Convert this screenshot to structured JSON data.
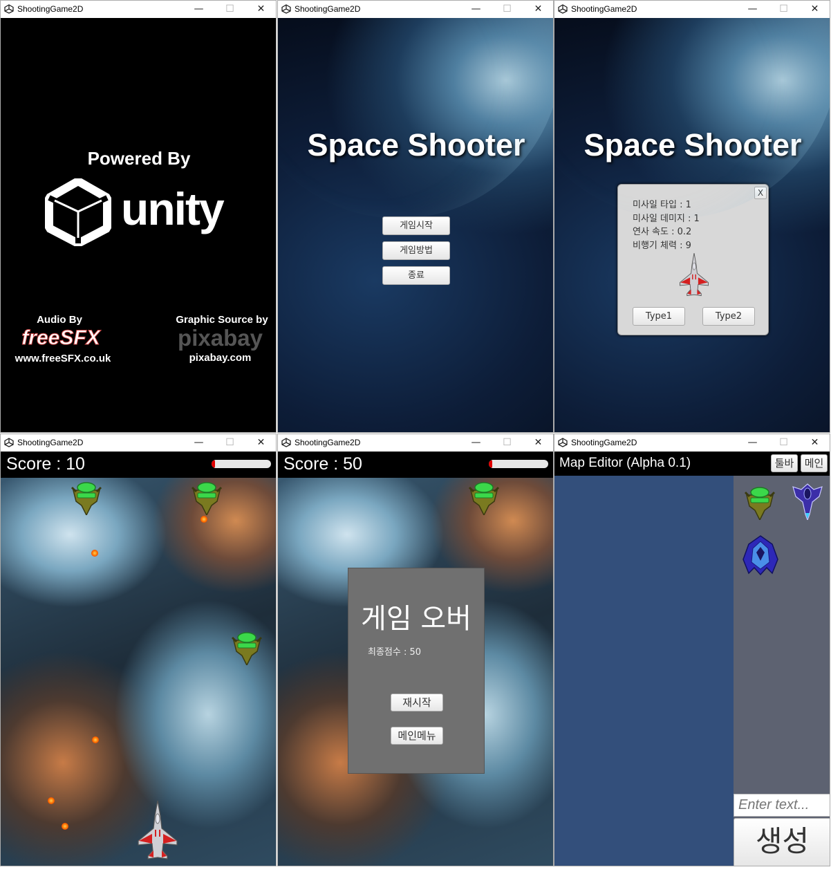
{
  "windows": [
    {
      "title": "ShootingGame2D"
    },
    {
      "title": "ShootingGame2D"
    },
    {
      "title": "ShootingGame2D"
    },
    {
      "title": "ShootingGame2D"
    },
    {
      "title": "ShootingGame2D"
    },
    {
      "title": "ShootingGame2D"
    }
  ],
  "window_controls": {
    "minimize": "—",
    "maximize": "☐",
    "close": "✕"
  },
  "splash": {
    "powered_by": "Powered By",
    "engine": "unity",
    "audio_by": "Audio By",
    "audio_brand": "freeSFX",
    "audio_url": "www.freeSFX.co.uk",
    "graphic_by": "Graphic Source by",
    "graphic_brand": "pixabay",
    "graphic_url": "pixabay.com"
  },
  "main_menu": {
    "title": "Space Shooter",
    "buttons": [
      "게임시작",
      "게임방법",
      "종료"
    ]
  },
  "ship_select": {
    "title": "Space Shooter",
    "close": "X",
    "stats": [
      "미사일 타입 : 1",
      "미사일 데미지 : 1",
      "연사 속도 : 0.2",
      "비행기 체력 : 9"
    ],
    "type1": "Type1",
    "type2": "Type2"
  },
  "gameplay": {
    "score": "Score : 10",
    "health_fraction": 0.06
  },
  "game_over": {
    "score": "Score : 50",
    "health_fraction": 0.06,
    "title": "게임 오버",
    "final_score": "최종점수 : 50",
    "restart": "재시작",
    "main_menu": "메인메뉴"
  },
  "map_editor": {
    "title": "Map Editor (Alpha 0.1)",
    "toolbar": "툴바",
    "main": "메인",
    "input_placeholder": "Enter text...",
    "create": "생성"
  },
  "colors": {
    "editor_canvas": "#334f7b",
    "editor_sidebar": "#5d6271",
    "enemy_green": "#3bd84a",
    "ship_red": "#d42020"
  },
  "icons": [
    "unity-logo-icon",
    "app-icon",
    "fighter-jet-icon",
    "green-enemy-ship-icon",
    "blue-enemy-ship-icon"
  ]
}
